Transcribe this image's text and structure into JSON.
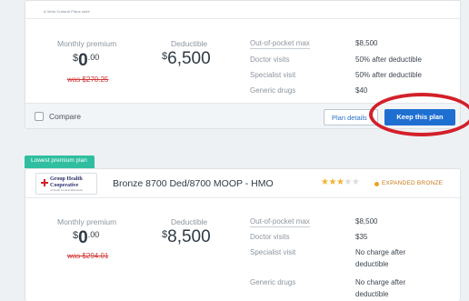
{
  "colors": {
    "accent_blue": "#1f6fd1",
    "strike_red": "#d13a3a",
    "badge_teal": "#2fbfa0",
    "star_gold": "#f2b233",
    "highlight_circle": "#d3202a"
  },
  "plan1": {
    "logo_text": "A Veris Cultural Plans suite",
    "monthly_premium_label": "Monthly premium",
    "premium_currency": "$",
    "premium_dollars": "0",
    "premium_cents": ".00",
    "premium_was": "was $270.25",
    "deductible_label": "Deductible",
    "deductible_currency": "$",
    "deductible_value": "6,500",
    "details": [
      {
        "label": "Out-of-pocket max",
        "value": "$8,500"
      },
      {
        "label": "Doctor visits",
        "value": "50% after deductible"
      },
      {
        "label": "Specialist visit",
        "value": "50% after deductible"
      },
      {
        "label": "Generic drugs",
        "value": "$40"
      }
    ],
    "compare_label": "Compare",
    "plan_details_label": "Plan details",
    "keep_label": "Keep this plan"
  },
  "plan2": {
    "badge": "Lowest premium plan",
    "logo_name": "Group Health Cooperative",
    "logo_sub": "of South Central Wisconsin",
    "plan_name": "Bronze 8700 Ded/8700 MOOP - HMO",
    "stars_filled": 3,
    "stars_total": 5,
    "metal_level": "EXPANDED BRONZE",
    "monthly_premium_label": "Monthly premium",
    "premium_currency": "$",
    "premium_dollars": "0",
    "premium_cents": ".00",
    "premium_was": "was $294.01",
    "deductible_label": "Deductible",
    "deductible_currency": "$",
    "deductible_value": "8,500",
    "details": [
      {
        "label": "Out-of-pocket max",
        "value": "$8,500"
      },
      {
        "label": "Doctor visits",
        "value": "$35"
      },
      {
        "label": "Specialist visit",
        "value": "No charge after deductible"
      },
      {
        "label": "Generic drugs",
        "value": "No charge after deductible"
      }
    ]
  }
}
